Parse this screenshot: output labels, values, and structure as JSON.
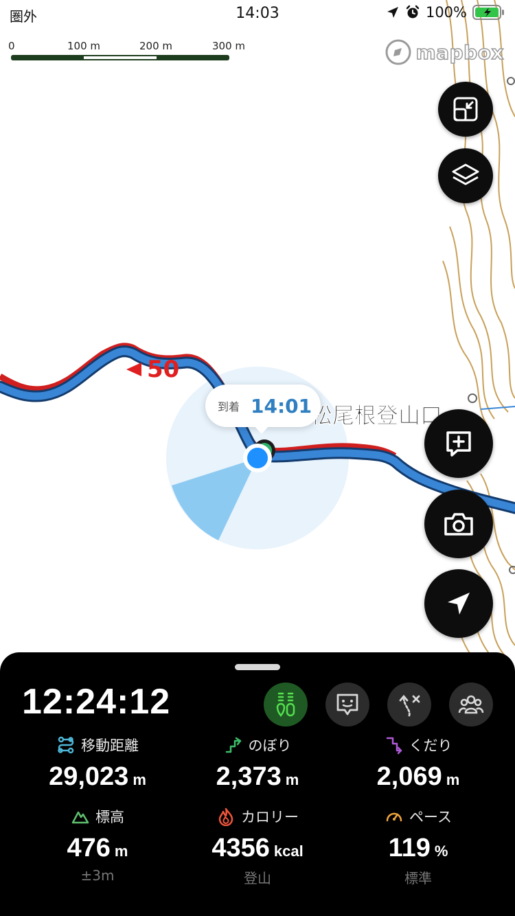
{
  "status_bar": {
    "carrier": "圏外",
    "time": "14:03",
    "battery": "100%"
  },
  "map": {
    "scale": {
      "labels": [
        "0",
        "100 m",
        "200 m",
        "300 m"
      ]
    },
    "attribution": "mapbox",
    "route_marker": "50",
    "place_name": "松尾根登山口",
    "arrival": {
      "label": "到着",
      "time": "14:01"
    },
    "colors": {
      "route": "#3a86d6",
      "route_outline": "#123b6e",
      "track": "#d01f1f",
      "contour": "#c79a4a",
      "accuracy": "#9fd0f5"
    }
  },
  "map_buttons": {
    "fullscreen": "fullscreen-icon",
    "layers": "layers-icon",
    "add_memo": "add-memo-icon",
    "camera": "camera-icon",
    "locate": "location-arrow-icon"
  },
  "panel": {
    "elapsed": "12:24:12",
    "icons": [
      "sensor-icon",
      "face-icon",
      "route-off-icon",
      "group-icon"
    ],
    "stats": [
      {
        "label": "移動距離",
        "value": "29,023",
        "unit": "m",
        "sub": "",
        "color": "#4fb6d6"
      },
      {
        "label": "のぼり",
        "value": "2,373",
        "unit": "m",
        "sub": "",
        "color": "#3dbd6a"
      },
      {
        "label": "くだり",
        "value": "2,069",
        "unit": "m",
        "sub": "",
        "color": "#b05ad8"
      },
      {
        "label": "標高",
        "value": "476",
        "unit": "m",
        "sub": "±3m",
        "color": "#5fbf6f"
      },
      {
        "label": "カロリー",
        "value": "4356",
        "unit": "kcal",
        "sub": "登山",
        "color": "#f0563c"
      },
      {
        "label": "ペース",
        "value": "119",
        "unit": "%",
        "sub": "標準",
        "color": "#f0a53c"
      }
    ]
  }
}
